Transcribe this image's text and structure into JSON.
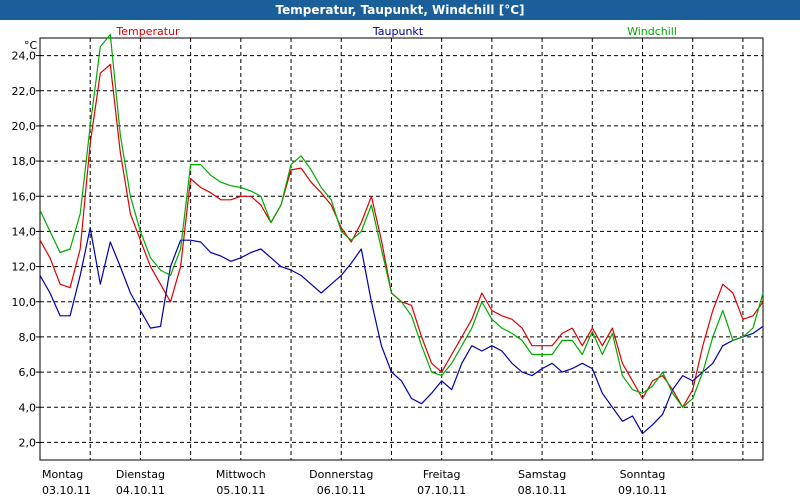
{
  "window_title": "Temperatur, Taupunkt, Windchill [°C]",
  "chart_data": {
    "type": "line",
    "title": "Temperatur, Taupunkt, Windchill [°C]",
    "ylabel": "°C",
    "ylim": [
      1.0,
      25.0
    ],
    "yticks": [
      "2,0",
      "4,0",
      "6,0",
      "8,0",
      "10,0",
      "12,0",
      "14,0",
      "16,0",
      "18,0",
      "20,0",
      "22,0",
      "24,0"
    ],
    "ytick_values": [
      2,
      4,
      6,
      8,
      10,
      12,
      14,
      16,
      18,
      20,
      22,
      24
    ],
    "xlim": [
      0,
      7.2
    ],
    "day_labels": [
      {
        "day": "Montag",
        "date": "03.10.11"
      },
      {
        "day": "Dienstag",
        "date": "04.10.11"
      },
      {
        "day": "Mittwoch",
        "date": "05.10.11"
      },
      {
        "day": "Donnerstag",
        "date": "06.10.11"
      },
      {
        "day": "Freitag",
        "date": "07.10.11"
      },
      {
        "day": "Samstag",
        "date": "08.10.11"
      },
      {
        "day": "Sonntag",
        "date": "09.10.11"
      }
    ],
    "grid": true,
    "legend_position": "top",
    "series": [
      {
        "name": "Temperatur",
        "color": "#dd0000",
        "x": [
          0,
          0.1,
          0.2,
          0.3,
          0.4,
          0.5,
          0.6,
          0.7,
          0.8,
          0.9,
          1.0,
          1.1,
          1.2,
          1.3,
          1.4,
          1.5,
          1.6,
          1.7,
          1.8,
          1.9,
          2.0,
          2.1,
          2.2,
          2.3,
          2.4,
          2.5,
          2.6,
          2.7,
          2.8,
          2.9,
          3.0,
          3.1,
          3.2,
          3.3,
          3.4,
          3.5,
          3.6,
          3.7,
          3.8,
          3.9,
          4.0,
          4.1,
          4.2,
          4.3,
          4.4,
          4.5,
          4.6,
          4.7,
          4.8,
          4.9,
          5.0,
          5.1,
          5.2,
          5.3,
          5.4,
          5.5,
          5.6,
          5.7,
          5.8,
          5.9,
          6.0,
          6.1,
          6.2,
          6.3,
          6.4,
          6.5,
          6.6,
          6.7,
          6.8,
          6.9,
          7.0,
          7.1,
          7.2
        ],
        "values": [
          13.5,
          12.5,
          11,
          10.8,
          13,
          19,
          23,
          23.5,
          18.5,
          15,
          13.5,
          12,
          11,
          10,
          12,
          17,
          16.5,
          16.2,
          15.8,
          15.8,
          16,
          16,
          15.5,
          14.5,
          15.5,
          17.5,
          17.6,
          16.8,
          16.2,
          15.5,
          14.2,
          13.4,
          14.5,
          16,
          13.5,
          10.5,
          10,
          9.8,
          8,
          6.5,
          6,
          7,
          8,
          9,
          10.5,
          9.5,
          9.2,
          9,
          8.5,
          7.5,
          7.5,
          7.5,
          8.2,
          8.5,
          7.5,
          8.5,
          7.5,
          8.5,
          6.5,
          5.5,
          4.5,
          5.5,
          5.8,
          5,
          4,
          5,
          7.5,
          9.5,
          11,
          10.5,
          9,
          9.2,
          10
        ]
      },
      {
        "name": "Taupunkt",
        "color": "#0000aa",
        "x": [
          0,
          0.1,
          0.2,
          0.3,
          0.4,
          0.5,
          0.6,
          0.7,
          0.8,
          0.9,
          1.0,
          1.1,
          1.2,
          1.3,
          1.4,
          1.5,
          1.6,
          1.7,
          1.8,
          1.9,
          2.0,
          2.1,
          2.2,
          2.3,
          2.4,
          2.5,
          2.6,
          2.7,
          2.8,
          2.9,
          3.0,
          3.1,
          3.2,
          3.3,
          3.4,
          3.5,
          3.6,
          3.7,
          3.8,
          3.9,
          4.0,
          4.1,
          4.2,
          4.3,
          4.4,
          4.5,
          4.6,
          4.7,
          4.8,
          4.9,
          5.0,
          5.1,
          5.2,
          5.3,
          5.4,
          5.5,
          5.6,
          5.7,
          5.8,
          5.9,
          6.0,
          6.1,
          6.2,
          6.3,
          6.4,
          6.5,
          6.6,
          6.7,
          6.8,
          6.9,
          7.0,
          7.1,
          7.2
        ],
        "values": [
          11.5,
          10.5,
          9.2,
          9.2,
          11.5,
          14.2,
          11,
          13.4,
          12,
          10.5,
          9.5,
          8.5,
          8.6,
          12,
          13.5,
          13.5,
          13.4,
          12.8,
          12.6,
          12.3,
          12.5,
          12.8,
          13,
          12.5,
          12,
          11.8,
          11.5,
          11,
          10.5,
          11,
          11.5,
          12.2,
          13,
          10,
          7.5,
          6,
          5.5,
          4.5,
          4.2,
          4.8,
          5.5,
          5,
          6.5,
          7.5,
          7.2,
          7.5,
          7.2,
          6.5,
          6,
          5.8,
          6.2,
          6.5,
          6,
          6.2,
          6.5,
          6.2,
          4.8,
          4,
          3.2,
          3.5,
          2.5,
          3,
          3.6,
          5,
          5.8,
          5.5,
          6,
          6.5,
          7.5,
          7.8,
          8,
          8.2,
          8.6
        ]
      },
      {
        "name": "Windchill",
        "color": "#00aa00",
        "x": [
          0,
          0.1,
          0.2,
          0.3,
          0.4,
          0.5,
          0.6,
          0.7,
          0.8,
          0.9,
          1.0,
          1.1,
          1.2,
          1.3,
          1.4,
          1.5,
          1.6,
          1.7,
          1.8,
          1.9,
          2.0,
          2.1,
          2.2,
          2.3,
          2.4,
          2.5,
          2.6,
          2.7,
          2.8,
          2.9,
          3.0,
          3.1,
          3.2,
          3.3,
          3.4,
          3.5,
          3.6,
          3.7,
          3.8,
          3.9,
          4.0,
          4.1,
          4.2,
          4.3,
          4.4,
          4.5,
          4.6,
          4.7,
          4.8,
          4.9,
          5.0,
          5.1,
          5.2,
          5.3,
          5.4,
          5.5,
          5.6,
          5.7,
          5.8,
          5.9,
          6.0,
          6.1,
          6.2,
          6.3,
          6.4,
          6.5,
          6.6,
          6.7,
          6.8,
          6.9,
          7.0,
          7.1,
          7.2
        ],
        "values": [
          15.2,
          14,
          12.8,
          13,
          15,
          20,
          24.5,
          25.2,
          19.5,
          16,
          14,
          12.5,
          11.8,
          11.5,
          13,
          17.8,
          17.8,
          17.2,
          16.8,
          16.6,
          16.5,
          16.3,
          16,
          14.5,
          15.5,
          17.8,
          18.3,
          17.5,
          16.5,
          15.8,
          14,
          13.5,
          14,
          15.5,
          13,
          10.5,
          10,
          9.2,
          7.5,
          6,
          5.8,
          6.5,
          7.5,
          8.5,
          10,
          9,
          8.5,
          8.2,
          7.8,
          7,
          7,
          7,
          7.8,
          7.8,
          7,
          8.3,
          7,
          8.2,
          5.8,
          5,
          4.8,
          5.2,
          6,
          4.8,
          4,
          4.5,
          6,
          8,
          9.5,
          7.8,
          8,
          8.5,
          10.5
        ]
      }
    ]
  }
}
